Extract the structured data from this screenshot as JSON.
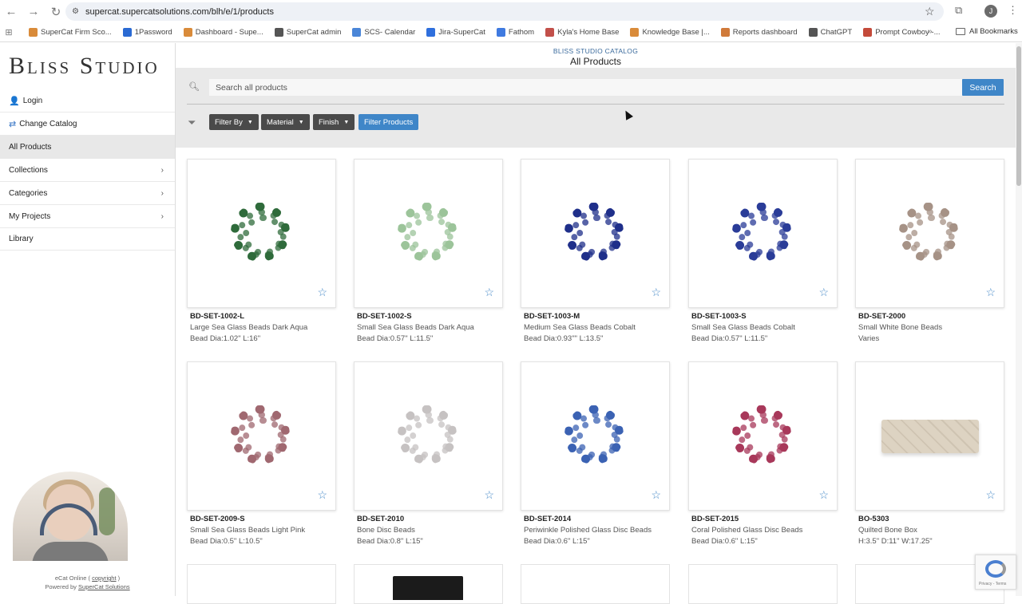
{
  "browser": {
    "url": "supercat.supercatsolutions.com/blh/e/1/products",
    "bookmarks": [
      {
        "label": "SuperCat Firm Sco...",
        "icon": "supercat-icon",
        "color": "#d98b3a"
      },
      {
        "label": "1Password",
        "icon": "onepassword-icon",
        "color": "#2a6ad3"
      },
      {
        "label": "Dashboard - Supe...",
        "icon": "supercat-icon",
        "color": "#d98b3a"
      },
      {
        "label": "SuperCat admin",
        "icon": "admin-icon",
        "color": "#555555"
      },
      {
        "label": "SCS- Calendar",
        "icon": "calendar-icon",
        "color": "#4a86d8"
      },
      {
        "label": "Jira-SuperCat",
        "icon": "jira-icon",
        "color": "#2f6fdd"
      },
      {
        "label": "Fathom",
        "icon": "fathom-icon",
        "color": "#3f7ae0"
      },
      {
        "label": "Kyla's Home Base",
        "icon": "home-base-icon",
        "color": "#c2504a"
      },
      {
        "label": "Knowledge Base |...",
        "icon": "supercat-icon",
        "color": "#d98b3a"
      },
      {
        "label": "Reports dashboard",
        "icon": "reports-icon",
        "color": "#d07a3a"
      },
      {
        "label": "ChatGPT",
        "icon": "chatgpt-icon",
        "color": "#555555"
      },
      {
        "label": "Prompt Cowboy -...",
        "icon": "cowboy-icon",
        "color": "#c44a3a"
      }
    ],
    "all_bookmarks": "All Bookmarks"
  },
  "sidebar": {
    "logo": "Bliss Studio",
    "items": [
      {
        "label": "Login",
        "icon": "user-icon"
      },
      {
        "label": "Change Catalog",
        "icon": "swap-icon"
      },
      {
        "label": "All Products",
        "icon": ""
      },
      {
        "label": "Collections",
        "icon": ""
      },
      {
        "label": "Categories",
        "icon": ""
      },
      {
        "label": "My Projects",
        "icon": ""
      },
      {
        "label": "Library",
        "icon": ""
      }
    ],
    "footer_line1_a": "eCat Online ( ",
    "footer_link1": "copyright",
    "footer_line1_b": " )",
    "footer_line2_a": "Powered by ",
    "footer_link2": "SuperCat Solutions"
  },
  "header": {
    "subtitle": "BLISS STUDIO CATALOG",
    "title": "All Products"
  },
  "search": {
    "placeholder": "Search all products",
    "button": "Search"
  },
  "filters": {
    "dropdowns": [
      "Filter By",
      "Material",
      "Finish"
    ],
    "apply": "Filter Products"
  },
  "products": [
    {
      "sku": "BD-SET-1002-L",
      "name": "Large Sea Glass Beads Dark Aqua",
      "dim": "Bead Dia:1.02\" L:16\"",
      "color": "#2f6b3b"
    },
    {
      "sku": "BD-SET-1002-S",
      "name": "Small Sea Glass Beads Dark Aqua",
      "dim": "Bead Dia:0.57\" L:11.5\"",
      "color": "#9cc49a"
    },
    {
      "sku": "BD-SET-1003-M",
      "name": "Medium Sea Glass Beads Cobalt",
      "dim": "Bead Dia:0.93\"\" L:13.5\"",
      "color": "#1f2f8a"
    },
    {
      "sku": "BD-SET-1003-S",
      "name": "Small Sea Glass Beads Cobalt",
      "dim": "Bead Dia:0.57\" L:11.5\"",
      "color": "#2a3c98"
    },
    {
      "sku": "BD-SET-2000",
      "name": "Small White Bone Beads",
      "dim": "Varies",
      "color": "#a69286"
    },
    {
      "sku": "BD-SET-2009-S",
      "name": "Small Sea Glass Beads Light Pink",
      "dim": "Bead Dia:0.5\" L:10.5\"",
      "color": "#a06870"
    },
    {
      "sku": "BD-SET-2010",
      "name": "Bone Disc Beads",
      "dim": "Bead Dia:0.8\" L:15\"",
      "color": "#c6c2c2"
    },
    {
      "sku": "BD-SET-2014",
      "name": "Periwinkle Polished Glass Disc Beads",
      "dim": "Bead Dia:0.6\" L:15\"",
      "color": "#3b62b3"
    },
    {
      "sku": "BD-SET-2015",
      "name": "Coral Polished Glass Disc Beads",
      "dim": "Bead Dia:0.6\" L:15\"",
      "color": "#a8385a"
    },
    {
      "sku": "BO-5303",
      "name": "Quilted Bone Box",
      "dim": "H:3.5\" D:11\" W:17.25\"",
      "color": "#ddd3c2"
    }
  ],
  "recaptcha": "Privacy - Terms"
}
